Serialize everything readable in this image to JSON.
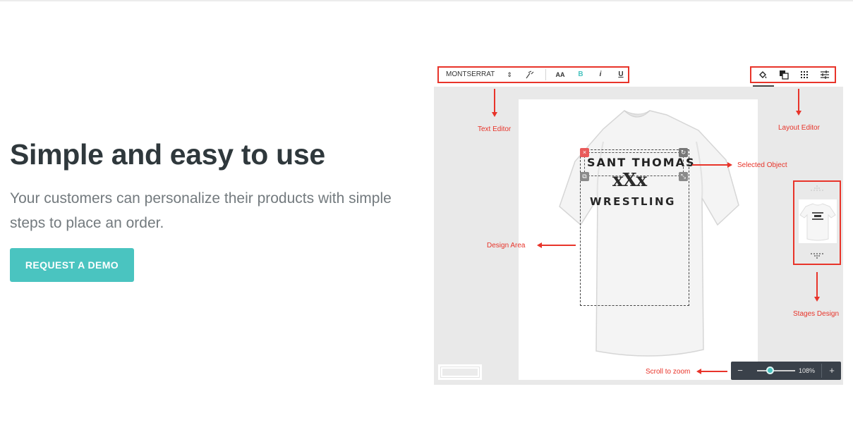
{
  "hero": {
    "title": "Simple and easy to use",
    "subtitle": "Your customers can personalize their products with simple steps to place an order.",
    "cta_label": "REQUEST A DEMO"
  },
  "editor": {
    "text_toolbar": {
      "font_name": "MONTSERRAT",
      "font_stepper_glyph": "⇕",
      "size_label": "AA",
      "bold_label": "B",
      "italic_label": "i",
      "underline_label": "U"
    },
    "layout_toolbar": {
      "icons": [
        "paint-bucket-icon",
        "layers-icon",
        "grid-icon",
        "sliders-icon"
      ]
    },
    "annotations": {
      "text_editor": "Text Editor",
      "layout_editor": "Layout Editor",
      "selected_object": "Selected Object",
      "design_area": "Design Area",
      "stages_design": "Stages Design",
      "scroll_to_zoom": "Scroll to zoom"
    },
    "shirt_print": {
      "line1": "SANT THOMAS",
      "line2": "xXx",
      "line3": "WRESTLING"
    },
    "zoom": {
      "minus": "−",
      "plus": "+",
      "value": "108%"
    },
    "colors": {
      "accent": "#4ac4c0",
      "annotation_red": "#e8342a",
      "zoom_bar": "#3a414a"
    }
  }
}
